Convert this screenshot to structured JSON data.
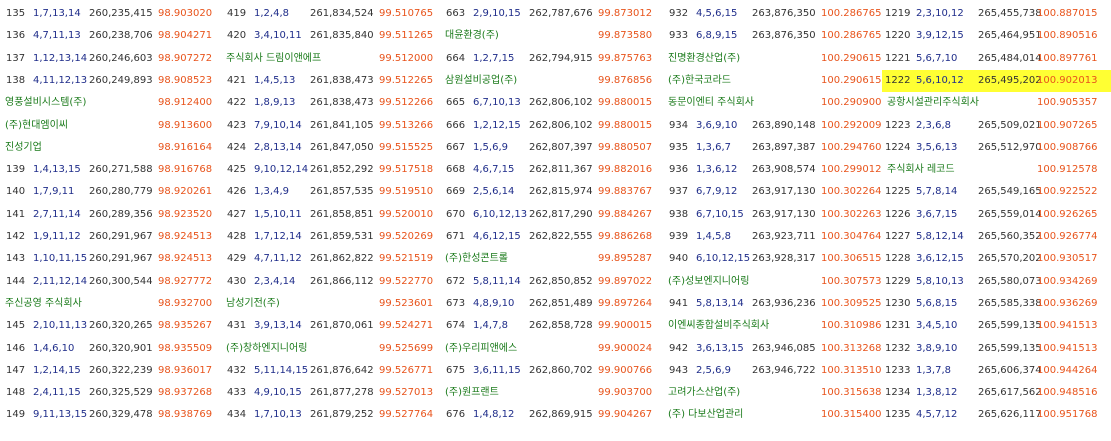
{
  "columns": [
    [
      {
        "no": "135",
        "combo": "1,7,13,14",
        "price": "260,235,415",
        "pct": "98.903020"
      },
      {
        "no": "136",
        "combo": "4,7,11,13",
        "price": "260,238,706",
        "pct": "98.904271"
      },
      {
        "no": "137",
        "combo": "1,12,13,14",
        "price": "260,246,603",
        "pct": "98.907272"
      },
      {
        "no": "138",
        "combo": "4,11,12,13",
        "price": "260,249,893",
        "pct": "98.908523"
      },
      {
        "company": "영풍설비시스템(주)",
        "pct": "98.912400"
      },
      {
        "company": "(주)현대엠이씨",
        "pct": "98.913600"
      },
      {
        "company": "진성기업",
        "pct": "98.916164"
      },
      {
        "no": "139",
        "combo": "1,4,13,15",
        "price": "260,271,588",
        "pct": "98.916768"
      },
      {
        "no": "140",
        "combo": "1,7,9,11",
        "price": "260,280,779",
        "pct": "98.920261"
      },
      {
        "no": "141",
        "combo": "2,7,11,14",
        "price": "260,289,356",
        "pct": "98.923520"
      },
      {
        "no": "142",
        "combo": "1,9,11,12",
        "price": "260,291,967",
        "pct": "98.924513"
      },
      {
        "no": "143",
        "combo": "1,10,11,15",
        "price": "260,291,967",
        "pct": "98.924513"
      },
      {
        "no": "144",
        "combo": "2,11,12,14",
        "price": "260,300,544",
        "pct": "98.927772"
      },
      {
        "company": "주신공영 주식회사",
        "pct": "98.932700"
      },
      {
        "no": "145",
        "combo": "2,10,11,13",
        "price": "260,320,265",
        "pct": "98.935267"
      },
      {
        "no": "146",
        "combo": "1,4,6,10",
        "price": "260,320,901",
        "pct": "98.935509"
      },
      {
        "no": "147",
        "combo": "1,2,14,15",
        "price": "260,322,239",
        "pct": "98.936017"
      },
      {
        "no": "148",
        "combo": "2,4,11,15",
        "price": "260,325,529",
        "pct": "98.937268"
      },
      {
        "no": "149",
        "combo": "9,11,13,15",
        "price": "260,329,478",
        "pct": "98.938769"
      }
    ],
    [
      {
        "no": "419",
        "combo": "1,2,4,8",
        "price": "261,834,524",
        "pct": "99.510765"
      },
      {
        "no": "420",
        "combo": "3,4,10,11",
        "price": "261,835,840",
        "pct": "99.511265"
      },
      {
        "company": "주식회사 드림이앤에프",
        "pct": "99.512000"
      },
      {
        "no": "421",
        "combo": "1,4,5,13",
        "price": "261,838,473",
        "pct": "99.512265"
      },
      {
        "no": "422",
        "combo": "1,8,9,13",
        "price": "261,838,473",
        "pct": "99.512266"
      },
      {
        "no": "423",
        "combo": "7,9,10,14",
        "price": "261,841,105",
        "pct": "99.513266"
      },
      {
        "no": "424",
        "combo": "2,8,13,14",
        "price": "261,847,050",
        "pct": "99.515525"
      },
      {
        "no": "425",
        "combo": "9,10,12,14",
        "price": "261,852,292",
        "pct": "99.517518"
      },
      {
        "no": "426",
        "combo": "1,3,4,9",
        "price": "261,857,535",
        "pct": "99.519510"
      },
      {
        "no": "427",
        "combo": "1,5,10,11",
        "price": "261,858,851",
        "pct": "99.520010"
      },
      {
        "no": "428",
        "combo": "1,7,12,14",
        "price": "261,859,531",
        "pct": "99.520269"
      },
      {
        "no": "429",
        "combo": "4,7,11,12",
        "price": "261,862,822",
        "pct": "99.521519"
      },
      {
        "no": "430",
        "combo": "2,3,4,14",
        "price": "261,866,112",
        "pct": "99.522770"
      },
      {
        "company": "남성기전(주)",
        "pct": "99.523601"
      },
      {
        "no": "431",
        "combo": "3,9,13,14",
        "price": "261,870,061",
        "pct": "99.524271"
      },
      {
        "company": "(주)창하엔지니어링",
        "pct": "99.525699"
      },
      {
        "no": "432",
        "combo": "5,11,14,15",
        "price": "261,876,642",
        "pct": "99.526771"
      },
      {
        "no": "433",
        "combo": "4,9,10,15",
        "price": "261,877,278",
        "pct": "99.527013"
      },
      {
        "no": "434",
        "combo": "1,7,10,13",
        "price": "261,879,252",
        "pct": "99.527764"
      }
    ],
    [
      {
        "no": "663",
        "combo": "2,9,10,15",
        "price": "262,787,676",
        "pct": "99.873012"
      },
      {
        "company": "대윤환경(주)",
        "pct": "99.873580"
      },
      {
        "no": "664",
        "combo": "1,2,7,15",
        "price": "262,794,915",
        "pct": "99.875763"
      },
      {
        "company": "삼원설비공업(주)",
        "pct": "99.876856"
      },
      {
        "no": "665",
        "combo": "6,7,10,13",
        "price": "262,806,102",
        "pct": "99.880015"
      },
      {
        "no": "666",
        "combo": "1,2,12,15",
        "price": "262,806,102",
        "pct": "99.880015"
      },
      {
        "no": "667",
        "combo": "1,5,6,9",
        "price": "262,807,397",
        "pct": "99.880507"
      },
      {
        "no": "668",
        "combo": "4,6,7,15",
        "price": "262,811,367",
        "pct": "99.882016"
      },
      {
        "no": "669",
        "combo": "2,5,6,14",
        "price": "262,815,974",
        "pct": "99.883767"
      },
      {
        "no": "670",
        "combo": "6,10,12,13",
        "price": "262,817,290",
        "pct": "99.884267"
      },
      {
        "no": "671",
        "combo": "4,6,12,15",
        "price": "262,822,555",
        "pct": "99.886268"
      },
      {
        "company": "(주)한성콘트롤",
        "pct": "99.895287"
      },
      {
        "no": "672",
        "combo": "5,8,11,14",
        "price": "262,850,852",
        "pct": "99.897022"
      },
      {
        "no": "673",
        "combo": "4,8,9,10",
        "price": "262,851,489",
        "pct": "99.897264"
      },
      {
        "no": "674",
        "combo": "1,4,7,8",
        "price": "262,858,728",
        "pct": "99.900015"
      },
      {
        "company": "(주)우리피앤에스",
        "pct": "99.900024"
      },
      {
        "no": "675",
        "combo": "3,6,11,15",
        "price": "262,860,702",
        "pct": "99.900766"
      },
      {
        "company": "(주)원프랜트",
        "pct": "99.903700"
      },
      {
        "no": "676",
        "combo": "1,4,8,12",
        "price": "262,869,915",
        "pct": "99.904267"
      }
    ],
    [
      {
        "no": "932",
        "combo": "4,5,6,15",
        "price": "263,876,350",
        "pct": "100.286765"
      },
      {
        "no": "933",
        "combo": "6,8,9,15",
        "price": "263,876,350",
        "pct": "100.286765"
      },
      {
        "company": "진명환경산업(주)",
        "pct": "100.290615"
      },
      {
        "company": "(주)한국코라드",
        "pct": "100.290615"
      },
      {
        "company": "동문이엔티 주식회사",
        "pct": "100.290900"
      },
      {
        "no": "934",
        "combo": "3,6,9,10",
        "price": "263,890,148",
        "pct": "100.292009"
      },
      {
        "no": "935",
        "combo": "1,3,6,7",
        "price": "263,897,387",
        "pct": "100.294760"
      },
      {
        "no": "936",
        "combo": "1,3,6,12",
        "price": "263,908,574",
        "pct": "100.299012"
      },
      {
        "no": "937",
        "combo": "6,7,9,12",
        "price": "263,917,130",
        "pct": "100.302264"
      },
      {
        "no": "938",
        "combo": "6,7,10,15",
        "price": "263,917,130",
        "pct": "100.302263"
      },
      {
        "no": "939",
        "combo": "1,4,5,8",
        "price": "263,923,711",
        "pct": "100.304764"
      },
      {
        "no": "940",
        "combo": "6,10,12,15",
        "price": "263,928,317",
        "pct": "100.306515"
      },
      {
        "company": "(주)성보엔지니어링",
        "pct": "100.307573"
      },
      {
        "no": "941",
        "combo": "5,8,13,14",
        "price": "263,936,236",
        "pct": "100.309525"
      },
      {
        "company": "이엔씨종합설비주식회사",
        "pct": "100.310986"
      },
      {
        "no": "942",
        "combo": "3,6,13,15",
        "price": "263,946,085",
        "pct": "100.313268"
      },
      {
        "no": "943",
        "combo": "2,5,6,9",
        "price": "263,946,722",
        "pct": "100.313510"
      },
      {
        "company": "고려가스산업(주)",
        "pct": "100.315638"
      },
      {
        "company": "(주) 다보산업관리",
        "pct": "100.315400"
      }
    ],
    [
      {
        "no": "1219",
        "combo": "2,3,10,12",
        "price": "265,455,738",
        "pct": "100.887015"
      },
      {
        "no": "1220",
        "combo": "3,9,12,15",
        "price": "265,464,951",
        "pct": "100.890516"
      },
      {
        "no": "1221",
        "combo": "5,6,7,10",
        "price": "265,484,014",
        "pct": "100.897761"
      },
      {
        "no": "1222",
        "combo": "5,6,10,12",
        "price": "265,495,202",
        "pct": "100.902013",
        "highlight": true
      },
      {
        "company": "공항시설관리주식회사",
        "pct": "100.905357"
      },
      {
        "no": "1223",
        "combo": "2,3,6,8",
        "price": "265,509,021",
        "pct": "100.907265"
      },
      {
        "no": "1224",
        "combo": "3,5,6,13",
        "price": "265,512,970",
        "pct": "100.908766"
      },
      {
        "company": "주식회사 레코드",
        "pct": "100.912578"
      },
      {
        "no": "1225",
        "combo": "5,7,8,14",
        "price": "265,549,165",
        "pct": "100.922522"
      },
      {
        "no": "1226",
        "combo": "3,6,7,15",
        "price": "265,559,014",
        "pct": "100.926265"
      },
      {
        "no": "1227",
        "combo": "5,8,12,14",
        "price": "265,560,352",
        "pct": "100.926774"
      },
      {
        "no": "1228",
        "combo": "3,6,12,15",
        "price": "265,570,202",
        "pct": "100.930517"
      },
      {
        "no": "1229",
        "combo": "5,8,10,13",
        "price": "265,580,073",
        "pct": "100.934269"
      },
      {
        "no": "1230",
        "combo": "5,6,8,15",
        "price": "265,585,338",
        "pct": "100.936269"
      },
      {
        "no": "1231",
        "combo": "3,4,5,10",
        "price": "265,599,135",
        "pct": "100.941513"
      },
      {
        "no": "1232",
        "combo": "3,8,9,10",
        "price": "265,599,135",
        "pct": "100.941513"
      },
      {
        "no": "1233",
        "combo": "1,3,7,8",
        "price": "265,606,374",
        "pct": "100.944264"
      },
      {
        "no": "1234",
        "combo": "1,3,8,12",
        "price": "265,617,562",
        "pct": "100.948516"
      },
      {
        "no": "1235",
        "combo": "4,5,7,12",
        "price": "265,626,117",
        "pct": "100.951768"
      }
    ]
  ],
  "colors": {
    "number": "#333333",
    "combo": "#1f2d8a",
    "price": "#333333",
    "percent": "#e8541c",
    "company": "#1a7a1a",
    "highlight": "#ffff33"
  }
}
